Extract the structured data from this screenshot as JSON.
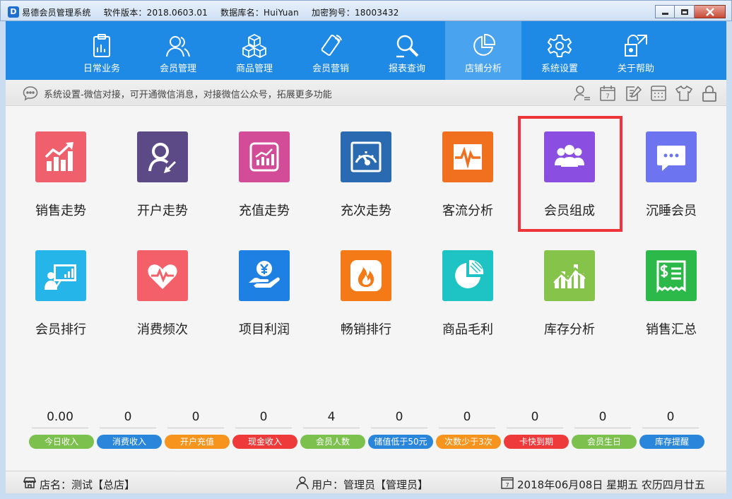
{
  "window": {
    "app_name": "易德会员管理系统",
    "version": "软件版本：2018.0603.01",
    "database": "数据库名：HuiYuan",
    "dongle": "加密狗号：18003432",
    "app_icon_letter": "D"
  },
  "nav": {
    "items": [
      {
        "label": "日常业务",
        "icon": "clipboard-icon"
      },
      {
        "label": "会员管理",
        "icon": "members-icon"
      },
      {
        "label": "商品管理",
        "icon": "cubes-icon"
      },
      {
        "label": "会员营销",
        "icon": "phone-icon"
      },
      {
        "label": "报表查询",
        "icon": "magnifier-icon"
      },
      {
        "label": "店铺分析",
        "icon": "pie-chart-icon",
        "active": true
      },
      {
        "label": "系统设置",
        "icon": "gear-icon"
      },
      {
        "label": "关于帮助",
        "icon": "help-icon"
      }
    ]
  },
  "info_bar": {
    "message": "系统设置-微信对接，可开通微信消息，对接微信公众号，拓展更多功能",
    "calendar_day": "7"
  },
  "tiles": [
    {
      "label": "销售走势",
      "color": "#f0606c",
      "icon": "sales-trend-icon"
    },
    {
      "label": "开户走势",
      "color": "#5b4a86",
      "icon": "account-open-icon"
    },
    {
      "label": "充值走势",
      "color": "#d34c98",
      "icon": "recharge-trend-icon"
    },
    {
      "label": "充次走势",
      "color": "#2a6ab0",
      "icon": "gauge-icon"
    },
    {
      "label": "客流分析",
      "color": "#f07020",
      "icon": "pulse-icon"
    },
    {
      "label": "会员组成",
      "color": "#8a4fe0",
      "icon": "member-group-icon"
    },
    {
      "label": "沉睡会员",
      "color": "#6c74f0",
      "icon": "chat-bubble-icon"
    },
    {
      "label": "会员排行",
      "color": "#25b5e8",
      "icon": "presentation-icon"
    },
    {
      "label": "消费频次",
      "color": "#f4606a",
      "icon": "heart-pulse-icon"
    },
    {
      "label": "项目利润",
      "color": "#1e80e2",
      "icon": "money-hand-icon"
    },
    {
      "label": "畅销排行",
      "color": "#f47a18",
      "icon": "flame-icon"
    },
    {
      "label": "商品毛利",
      "color": "#1ec4c4",
      "icon": "pie-icon"
    },
    {
      "label": "库存分析",
      "color": "#86c34a",
      "icon": "inventory-chart-icon"
    },
    {
      "label": "销售汇总",
      "color": "#2db84a",
      "icon": "receipt-icon"
    }
  ],
  "stats": [
    {
      "value": "0.00",
      "label": "今日收入",
      "color": "#7cc14d"
    },
    {
      "value": "0",
      "label": "消费收入",
      "color": "#2a86db"
    },
    {
      "value": "0",
      "label": "开户充值",
      "color": "#f6941d"
    },
    {
      "value": "0",
      "label": "现金收入",
      "color": "#ee3a3a"
    },
    {
      "value": "4",
      "label": "会员人数",
      "color": "#7cc14d"
    },
    {
      "value": "0",
      "label": "储值低于50元",
      "color": "#2a86db"
    },
    {
      "value": "0",
      "label": "次数少于3次",
      "color": "#f6941d"
    },
    {
      "value": "0",
      "label": "卡快到期",
      "color": "#ee3a3a"
    },
    {
      "value": "0",
      "label": "会员生日",
      "color": "#7cc14d"
    },
    {
      "value": "0",
      "label": "库存提醒",
      "color": "#2a86db"
    }
  ],
  "status_bar": {
    "store": "店名：测试【总店】",
    "user": "用户：管理员【管理员】",
    "date": "2018年06月08日 星期五 农历四月廿五",
    "calendar_day": "7"
  }
}
